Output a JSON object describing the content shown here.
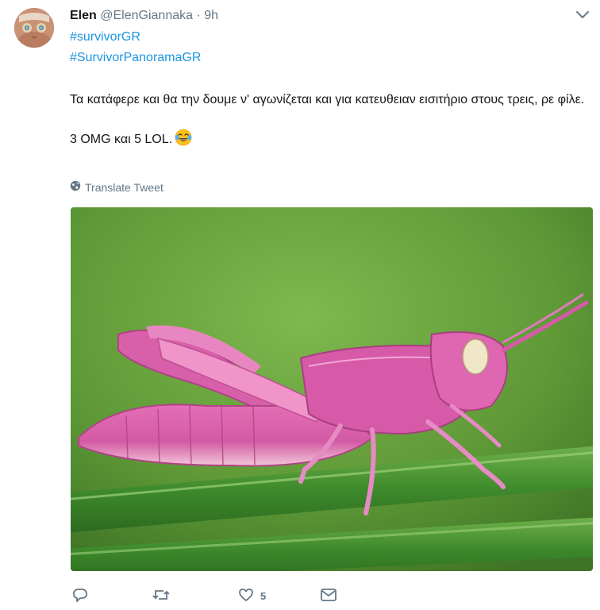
{
  "tweet": {
    "author_name": "Elen",
    "author_handle": "@ElenGiannaka",
    "separator": "·",
    "timestamp": "9h",
    "hashtags": [
      "#survivorGR",
      "#SurvivorPanoramaGR"
    ],
    "text_line1": "Τα κατάφερε και θα την δουμε ν' αγωνίζεται και για κατευθειαν εισιτήριο στους τρεις, ρε φίλε.",
    "text_line2": "3 OMG και 5 LOL.",
    "emoji": "face-with-tears-of-joy",
    "translate_label": "Translate Tweet",
    "media_alt": "pink grasshopper on green stem",
    "like_count": "5"
  },
  "icons": {
    "caret": "chevron-down-icon",
    "globe": "globe-icon",
    "reply": "reply-icon",
    "retweet": "retweet-icon",
    "like": "heart-icon",
    "dm": "envelope-icon"
  },
  "colors": {
    "link": "#1b95e0",
    "secondary_text": "#657786",
    "primary_text": "#14171a",
    "background": "#ffffff"
  }
}
